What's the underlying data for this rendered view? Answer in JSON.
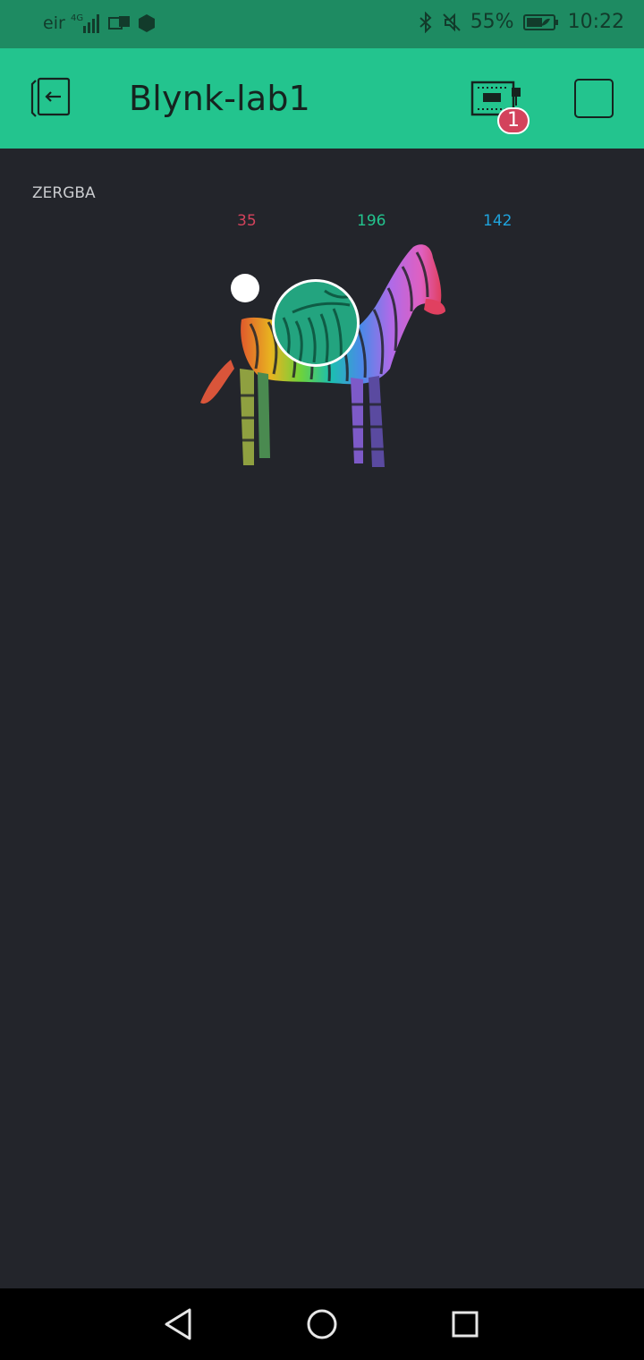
{
  "status_bar": {
    "carrier": "eir",
    "network": "4G",
    "battery_percent": "55%",
    "time": "10:22"
  },
  "app_bar": {
    "title": "Blynk-lab1",
    "device_badge_count": "1"
  },
  "widget": {
    "label": "ZERGBA",
    "red": "35",
    "green": "196",
    "blue": "142",
    "selected_color": "#23a47f"
  },
  "colors": {
    "accent": "#23c48e",
    "statusbar": "#1e8b62",
    "background": "#23252b",
    "red_value": "#d3435c",
    "green_value": "#23c48e",
    "blue_value": "#1fa3dc",
    "badge": "#d3435c"
  },
  "icons": {
    "back": "exit-arrow-icon",
    "device": "hardware-board-icon",
    "stop": "stop-square-icon",
    "nav_back": "triangle-back-icon",
    "nav_home": "circle-home-icon",
    "nav_recent": "square-recent-icon"
  }
}
